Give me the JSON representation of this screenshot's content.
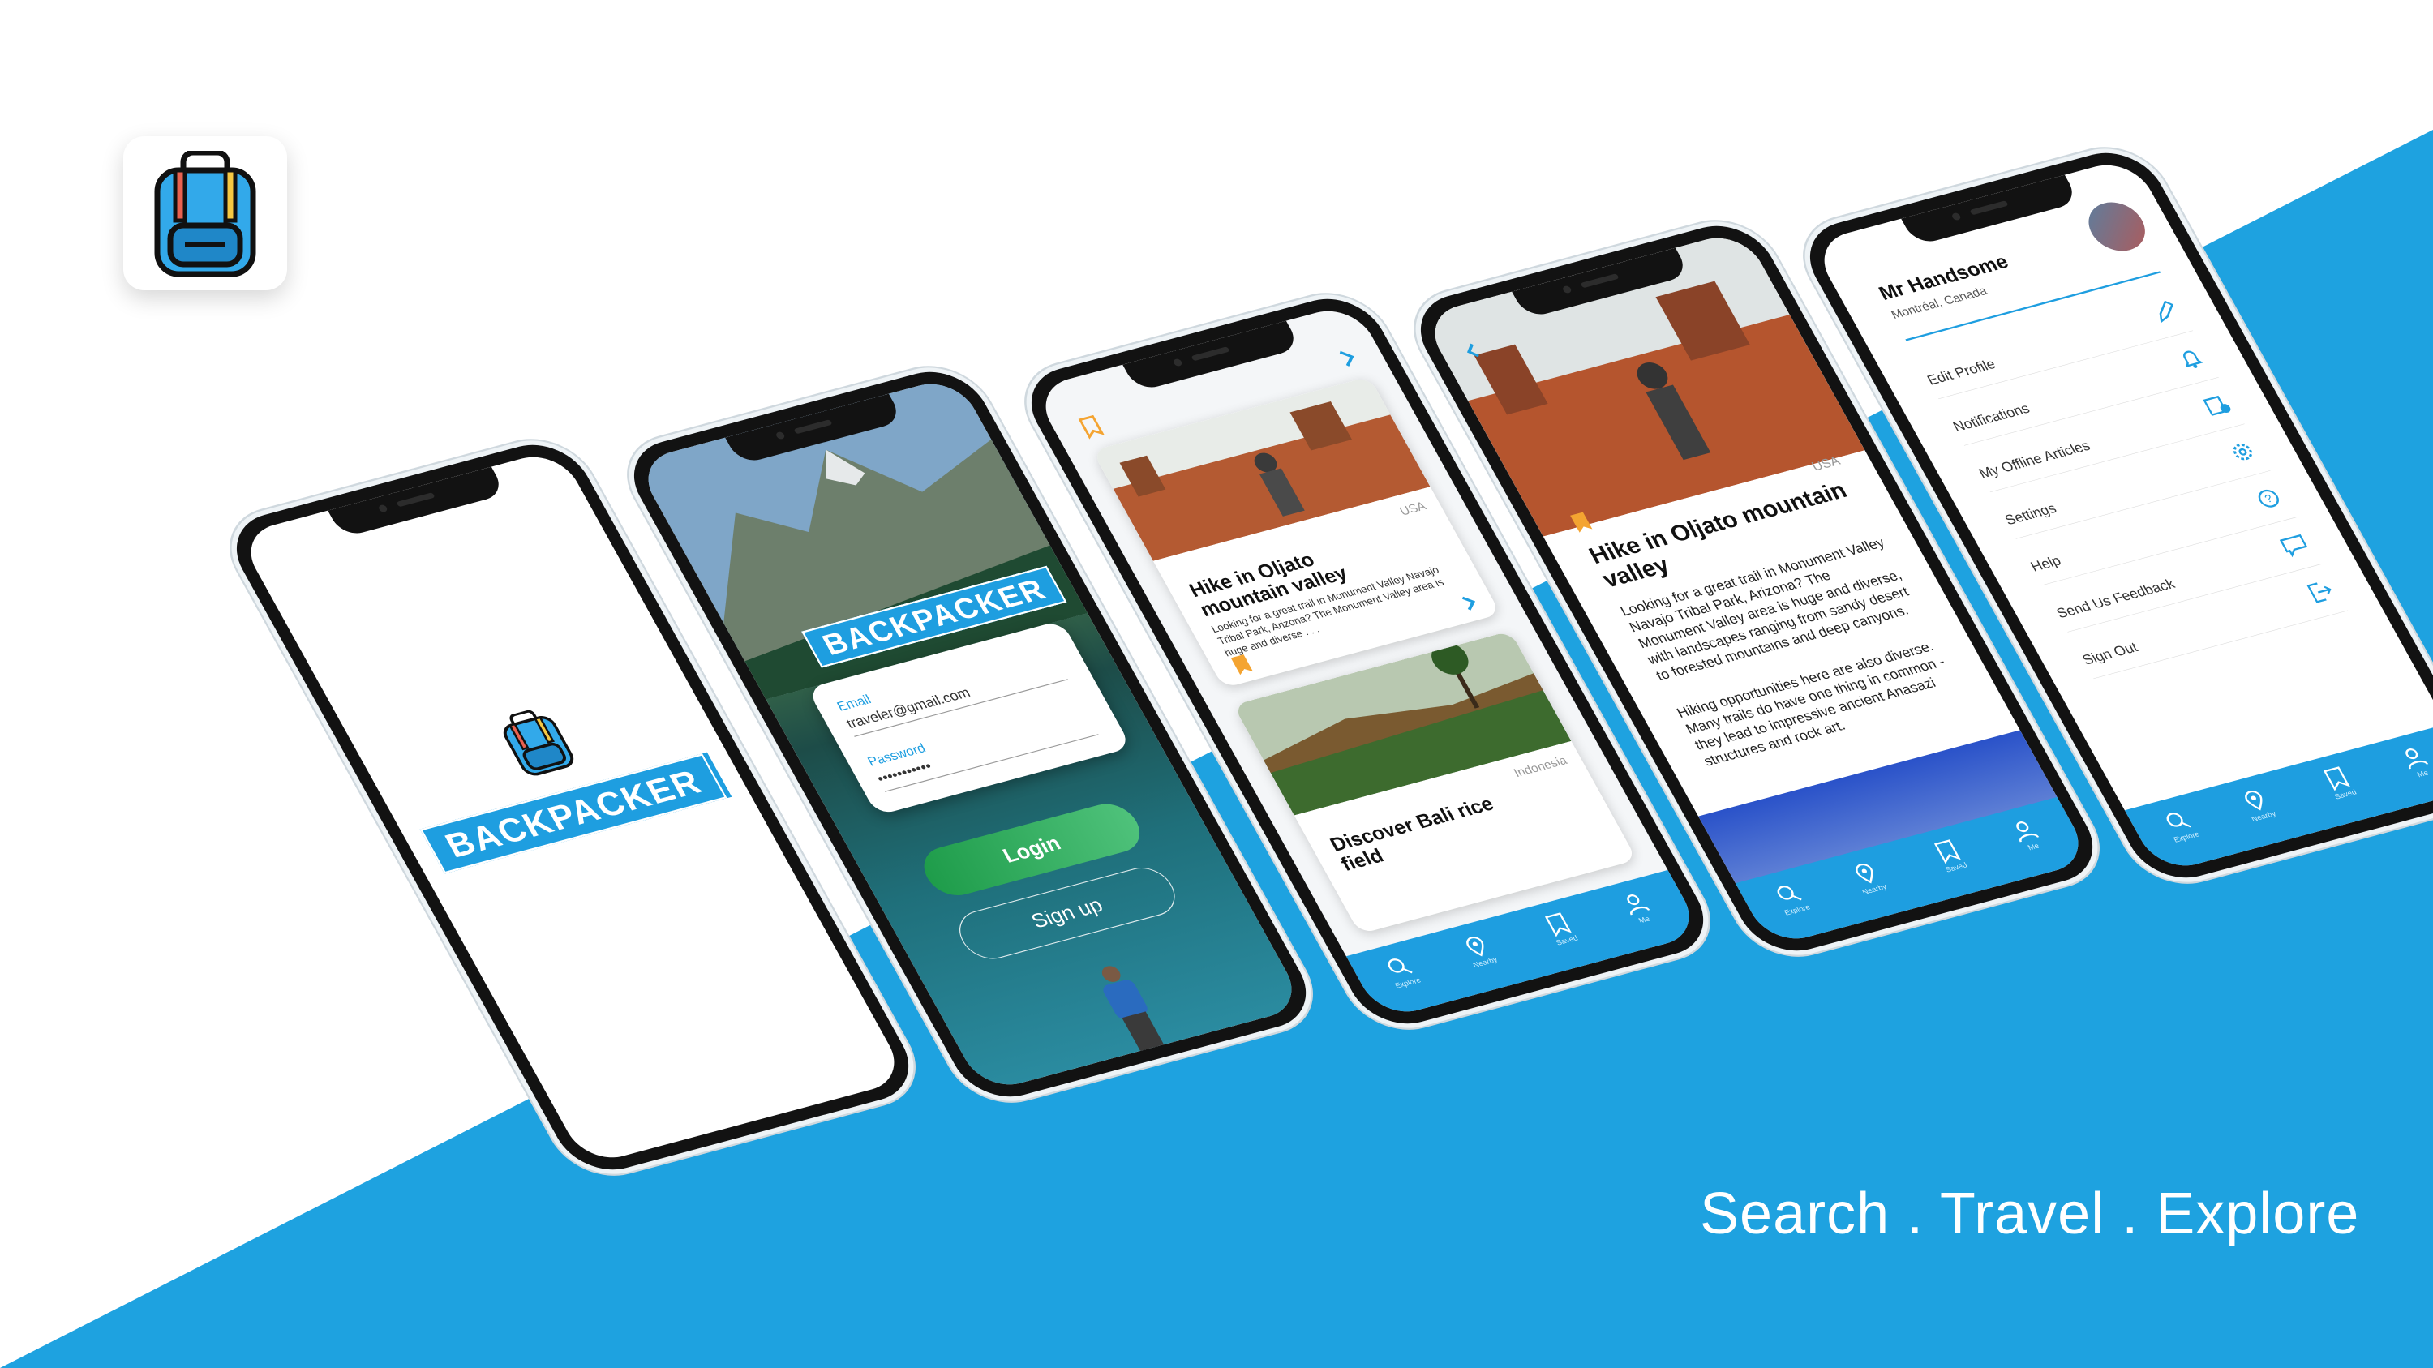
{
  "tagline": "Search . Travel . Explore",
  "colors": {
    "brand_blue": "#1e9ee0",
    "login_green": "#2fae62",
    "bookmark": "#f4a431"
  },
  "brand": {
    "wordmark": "BACKPACKER"
  },
  "login": {
    "email_label": "Email",
    "email_value": "traveler@gmail.com",
    "password_label": "Password",
    "password_value": "•••••••••••",
    "login_button": "Login",
    "signup_button": "Sign up"
  },
  "feed": {
    "cards": [
      {
        "country": "USA",
        "title": "Hike in Oljato mountain valley",
        "description": "Looking for a great trail in Monument Valley Navajo Tribal Park, Arizona? The Monument Valley area is huge and diverse . . ."
      },
      {
        "country": "Indonesia",
        "title": "Discover Bali rice field",
        "description": ""
      }
    ]
  },
  "article": {
    "country": "USA",
    "title": "Hike in Oljato mountain valley",
    "paragraph1": "Looking for a great trail in Monument Valley Navajo Tribal Park, Arizona? The Monument Valley area is huge and diverse, with landscapes ranging from sandy desert to forested mountains and deep canyons.",
    "paragraph2": "Hiking opportunities here are also diverse. Many trails do have one thing in common - they lead to impressive ancient Anasazi structures and rock art."
  },
  "profile": {
    "name": "Mr Handsome",
    "location": "Montréal, Canada",
    "menu": [
      {
        "label": "Edit Profile",
        "icon": "edit-icon"
      },
      {
        "label": "Notifications",
        "icon": "bell-icon"
      },
      {
        "label": "My Offline Articles",
        "icon": "offline-articles-icon"
      },
      {
        "label": "Settings",
        "icon": "gear-icon"
      },
      {
        "label": "Help",
        "icon": "help-icon"
      },
      {
        "label": "Send Us Feedback",
        "icon": "feedback-icon"
      },
      {
        "label": "Sign Out",
        "icon": "sign-out-icon"
      }
    ]
  },
  "tabs": [
    {
      "label": "Explore",
      "icon": "search-icon"
    },
    {
      "label": "Nearby",
      "icon": "map-pin-icon"
    },
    {
      "label": "Saved",
      "icon": "bookmark-icon"
    },
    {
      "label": "Me",
      "icon": "user-icon"
    }
  ]
}
